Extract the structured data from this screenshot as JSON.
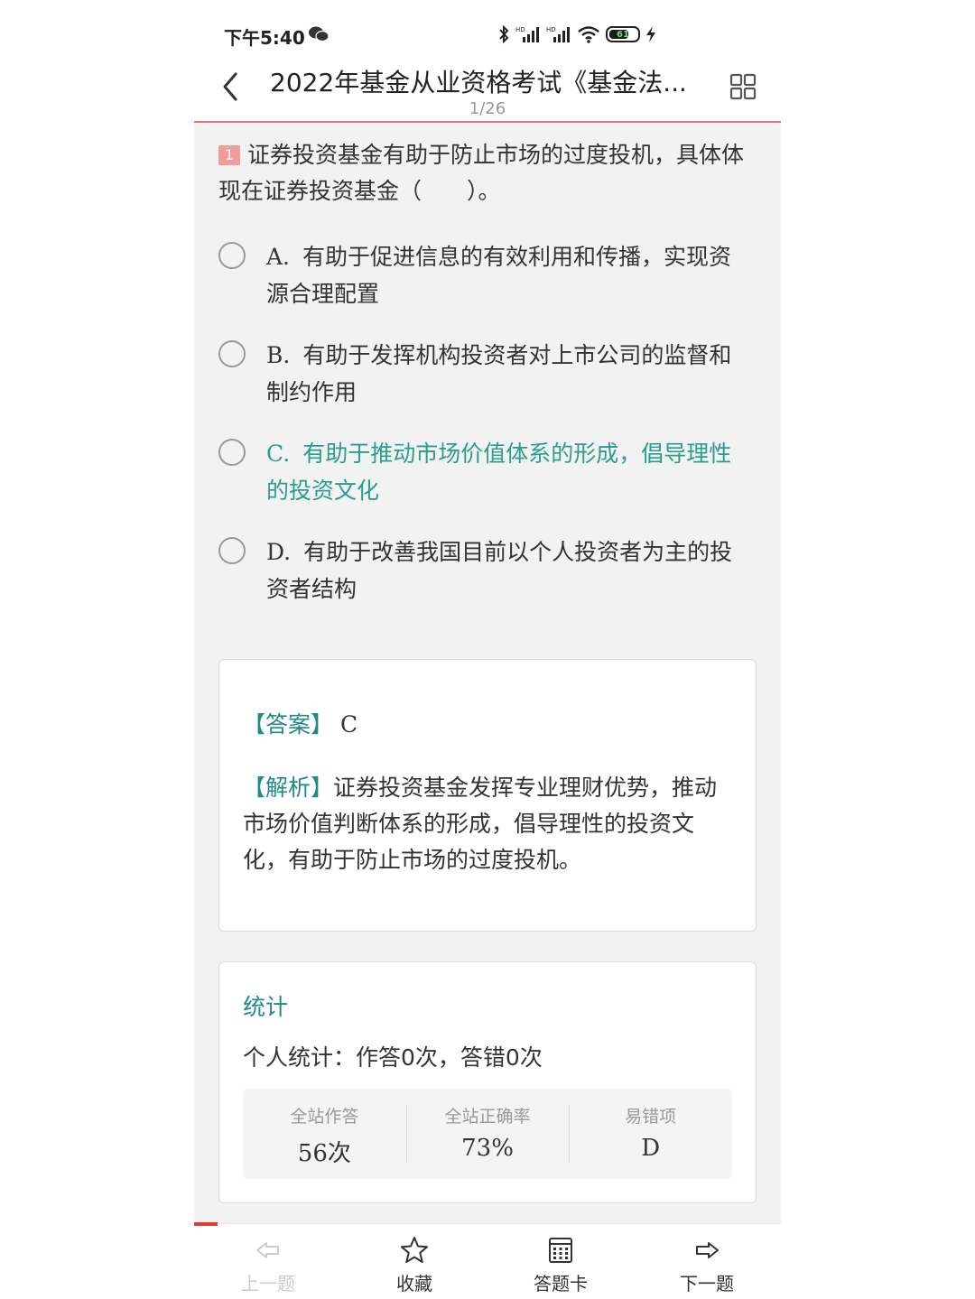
{
  "status_bar": {
    "time": "下午5:40",
    "battery": "61"
  },
  "header": {
    "title": "2022年基金从业资格考试《基金法...",
    "page_counter": "1/26"
  },
  "question": {
    "number": "1",
    "text": "证券投资基金有助于防止市场的过度投机，具体体现在证券投资基金（　　）。",
    "options": [
      {
        "letter": "A.",
        "text": "有助于促进信息的有效利用和传播，实现资源合理配置"
      },
      {
        "letter": "B.",
        "text": "有助于发挥机构投资者对上市公司的监督和制约作用"
      },
      {
        "letter": "C.",
        "text": "有助于推动市场价值体系的形成，倡导理性的投资文化"
      },
      {
        "letter": "D.",
        "text": "有助于改善我国目前以个人投资者为主的投资者结构"
      }
    ]
  },
  "answer": {
    "answer_tag": "【答案】",
    "answer_value": "C",
    "analysis_tag": "【解析】",
    "analysis_text": "证券投资基金发挥专业理财优势，推动市场价值判断体系的形成，倡导理性的投资文化，有助于防止市场的过度投机。"
  },
  "stats": {
    "title": "统计",
    "personal": "个人统计：作答0次，答错0次",
    "columns": [
      {
        "label": "全站作答",
        "value": "56次"
      },
      {
        "label": "全站正确率",
        "value": "73%"
      },
      {
        "label": "易错项",
        "value": "D"
      }
    ]
  },
  "bottom_nav": {
    "prev": "上一题",
    "favorite": "收藏",
    "answer_card": "答题卡",
    "next": "下一题"
  },
  "colors": {
    "accent_teal": "#2a9d8f",
    "header_rule": "#e57373",
    "question_badge": "#f29b9b"
  }
}
